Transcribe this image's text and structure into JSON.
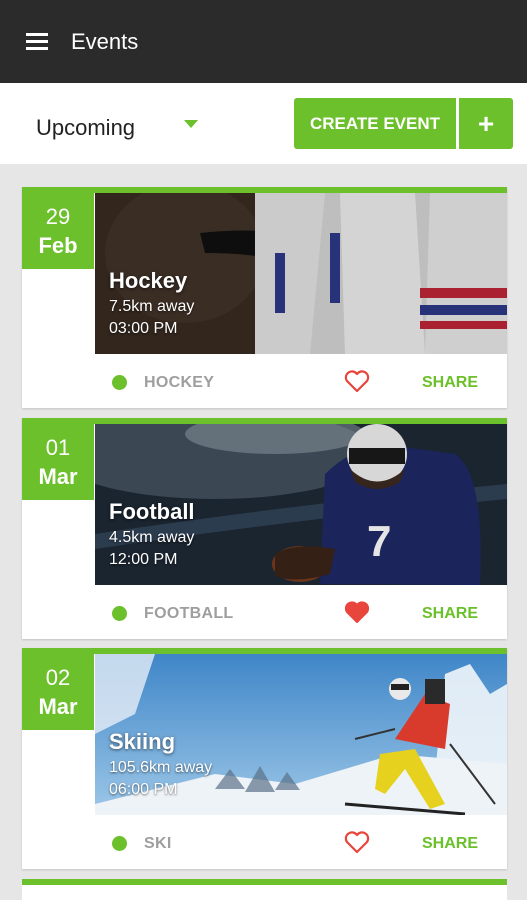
{
  "appbar": {
    "title": "Events"
  },
  "toolbar": {
    "filter_value": "Upcoming",
    "create_label": "CREATE EVENT",
    "plus_label": "+"
  },
  "events": [
    {
      "day": "29",
      "month": "Feb",
      "name": "Hockey",
      "distance": "7.5km away",
      "time": "03:00 PM",
      "category": "HOCKEY",
      "liked": false,
      "share_label": "SHARE"
    },
    {
      "day": "01",
      "month": "Mar",
      "name": "Football",
      "distance": "4.5km away",
      "time": "12:00 PM",
      "category": "FOOTBALL",
      "liked": true,
      "share_label": "SHARE"
    },
    {
      "day": "02",
      "month": "Mar",
      "name": "Skiing",
      "distance": "105.6km away",
      "time": "06:00 PM",
      "category": "SKI",
      "liked": false,
      "share_label": "SHARE"
    }
  ],
  "colors": {
    "accent": "#6cc02b",
    "appbar": "#2b2b2b",
    "heart": "#e8453c"
  }
}
